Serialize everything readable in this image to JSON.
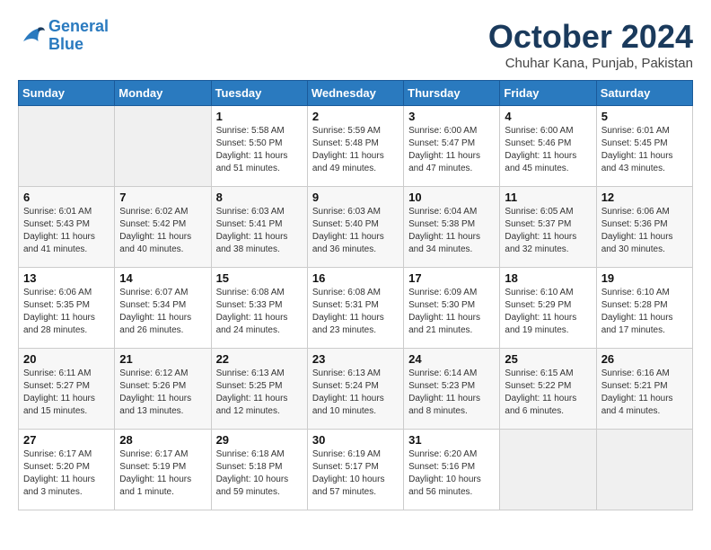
{
  "header": {
    "logo_line1": "General",
    "logo_line2": "Blue",
    "month": "October 2024",
    "location": "Chuhar Kana, Punjab, Pakistan"
  },
  "weekdays": [
    "Sunday",
    "Monday",
    "Tuesday",
    "Wednesday",
    "Thursday",
    "Friday",
    "Saturday"
  ],
  "weeks": [
    [
      {
        "day": "",
        "info": ""
      },
      {
        "day": "",
        "info": ""
      },
      {
        "day": "1",
        "info": "Sunrise: 5:58 AM\nSunset: 5:50 PM\nDaylight: 11 hours and 51 minutes."
      },
      {
        "day": "2",
        "info": "Sunrise: 5:59 AM\nSunset: 5:48 PM\nDaylight: 11 hours and 49 minutes."
      },
      {
        "day": "3",
        "info": "Sunrise: 6:00 AM\nSunset: 5:47 PM\nDaylight: 11 hours and 47 minutes."
      },
      {
        "day": "4",
        "info": "Sunrise: 6:00 AM\nSunset: 5:46 PM\nDaylight: 11 hours and 45 minutes."
      },
      {
        "day": "5",
        "info": "Sunrise: 6:01 AM\nSunset: 5:45 PM\nDaylight: 11 hours and 43 minutes."
      }
    ],
    [
      {
        "day": "6",
        "info": "Sunrise: 6:01 AM\nSunset: 5:43 PM\nDaylight: 11 hours and 41 minutes."
      },
      {
        "day": "7",
        "info": "Sunrise: 6:02 AM\nSunset: 5:42 PM\nDaylight: 11 hours and 40 minutes."
      },
      {
        "day": "8",
        "info": "Sunrise: 6:03 AM\nSunset: 5:41 PM\nDaylight: 11 hours and 38 minutes."
      },
      {
        "day": "9",
        "info": "Sunrise: 6:03 AM\nSunset: 5:40 PM\nDaylight: 11 hours and 36 minutes."
      },
      {
        "day": "10",
        "info": "Sunrise: 6:04 AM\nSunset: 5:38 PM\nDaylight: 11 hours and 34 minutes."
      },
      {
        "day": "11",
        "info": "Sunrise: 6:05 AM\nSunset: 5:37 PM\nDaylight: 11 hours and 32 minutes."
      },
      {
        "day": "12",
        "info": "Sunrise: 6:06 AM\nSunset: 5:36 PM\nDaylight: 11 hours and 30 minutes."
      }
    ],
    [
      {
        "day": "13",
        "info": "Sunrise: 6:06 AM\nSunset: 5:35 PM\nDaylight: 11 hours and 28 minutes."
      },
      {
        "day": "14",
        "info": "Sunrise: 6:07 AM\nSunset: 5:34 PM\nDaylight: 11 hours and 26 minutes."
      },
      {
        "day": "15",
        "info": "Sunrise: 6:08 AM\nSunset: 5:33 PM\nDaylight: 11 hours and 24 minutes."
      },
      {
        "day": "16",
        "info": "Sunrise: 6:08 AM\nSunset: 5:31 PM\nDaylight: 11 hours and 23 minutes."
      },
      {
        "day": "17",
        "info": "Sunrise: 6:09 AM\nSunset: 5:30 PM\nDaylight: 11 hours and 21 minutes."
      },
      {
        "day": "18",
        "info": "Sunrise: 6:10 AM\nSunset: 5:29 PM\nDaylight: 11 hours and 19 minutes."
      },
      {
        "day": "19",
        "info": "Sunrise: 6:10 AM\nSunset: 5:28 PM\nDaylight: 11 hours and 17 minutes."
      }
    ],
    [
      {
        "day": "20",
        "info": "Sunrise: 6:11 AM\nSunset: 5:27 PM\nDaylight: 11 hours and 15 minutes."
      },
      {
        "day": "21",
        "info": "Sunrise: 6:12 AM\nSunset: 5:26 PM\nDaylight: 11 hours and 13 minutes."
      },
      {
        "day": "22",
        "info": "Sunrise: 6:13 AM\nSunset: 5:25 PM\nDaylight: 11 hours and 12 minutes."
      },
      {
        "day": "23",
        "info": "Sunrise: 6:13 AM\nSunset: 5:24 PM\nDaylight: 11 hours and 10 minutes."
      },
      {
        "day": "24",
        "info": "Sunrise: 6:14 AM\nSunset: 5:23 PM\nDaylight: 11 hours and 8 minutes."
      },
      {
        "day": "25",
        "info": "Sunrise: 6:15 AM\nSunset: 5:22 PM\nDaylight: 11 hours and 6 minutes."
      },
      {
        "day": "26",
        "info": "Sunrise: 6:16 AM\nSunset: 5:21 PM\nDaylight: 11 hours and 4 minutes."
      }
    ],
    [
      {
        "day": "27",
        "info": "Sunrise: 6:17 AM\nSunset: 5:20 PM\nDaylight: 11 hours and 3 minutes."
      },
      {
        "day": "28",
        "info": "Sunrise: 6:17 AM\nSunset: 5:19 PM\nDaylight: 11 hours and 1 minute."
      },
      {
        "day": "29",
        "info": "Sunrise: 6:18 AM\nSunset: 5:18 PM\nDaylight: 10 hours and 59 minutes."
      },
      {
        "day": "30",
        "info": "Sunrise: 6:19 AM\nSunset: 5:17 PM\nDaylight: 10 hours and 57 minutes."
      },
      {
        "day": "31",
        "info": "Sunrise: 6:20 AM\nSunset: 5:16 PM\nDaylight: 10 hours and 56 minutes."
      },
      {
        "day": "",
        "info": ""
      },
      {
        "day": "",
        "info": ""
      }
    ]
  ]
}
